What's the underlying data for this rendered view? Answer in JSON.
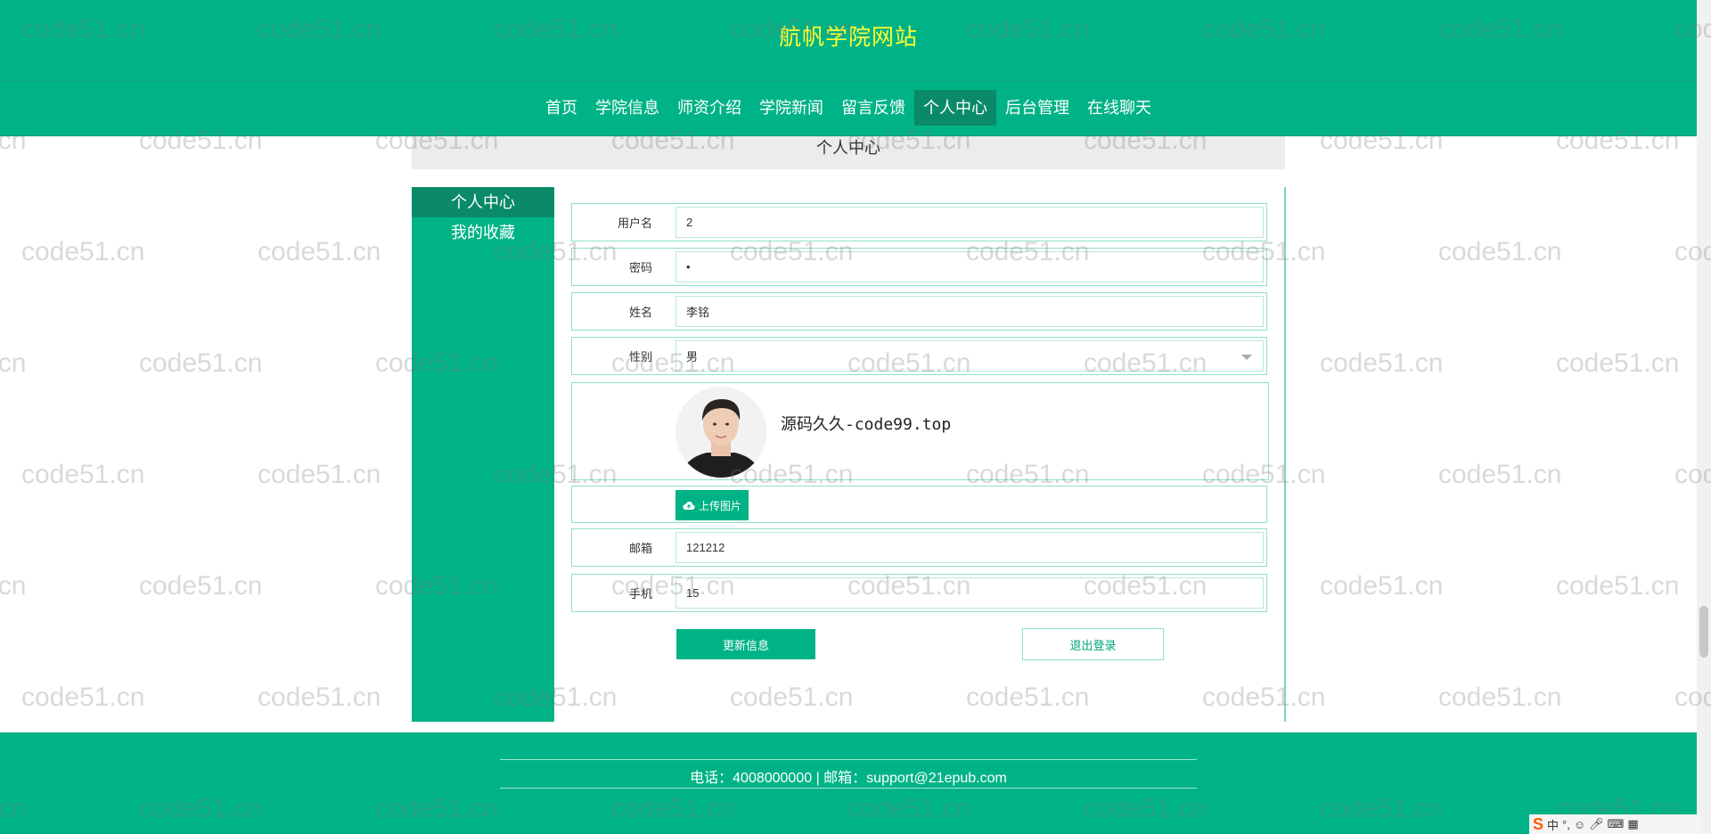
{
  "site": {
    "title": "航帆学院网站"
  },
  "nav": [
    {
      "label": "首页"
    },
    {
      "label": "学院信息"
    },
    {
      "label": "师资介绍"
    },
    {
      "label": "学院新闻"
    },
    {
      "label": "留言反馈"
    },
    {
      "label": "个人中心",
      "active": true
    },
    {
      "label": "后台管理"
    },
    {
      "label": "在线聊天"
    }
  ],
  "section": {
    "title": "个人中心"
  },
  "side_menu": [
    {
      "label": "个人中心",
      "active": true
    },
    {
      "label": "我的收藏"
    }
  ],
  "form": {
    "username": {
      "label": "用户名",
      "value": "2"
    },
    "password": {
      "label": "密码",
      "value": "•"
    },
    "name": {
      "label": "姓名",
      "value": "李铭"
    },
    "gender": {
      "label": "性别",
      "value": "男"
    },
    "avatar_caption": "源码久久-code99.top",
    "upload_label": "上传图片",
    "email": {
      "label": "邮箱",
      "value": "121212"
    },
    "phone": {
      "label": "手机",
      "value": "15"
    }
  },
  "buttons": {
    "update": "更新信息",
    "logout": "退出登录"
  },
  "footer": {
    "text": "电话：4008000000 | 邮箱：support@21epub.com"
  },
  "watermark": "code51.cn",
  "colors": {
    "primary": "#00b386",
    "active": "#0a8a68",
    "title": "#ffff33"
  },
  "tray": {
    "ime": "中"
  }
}
